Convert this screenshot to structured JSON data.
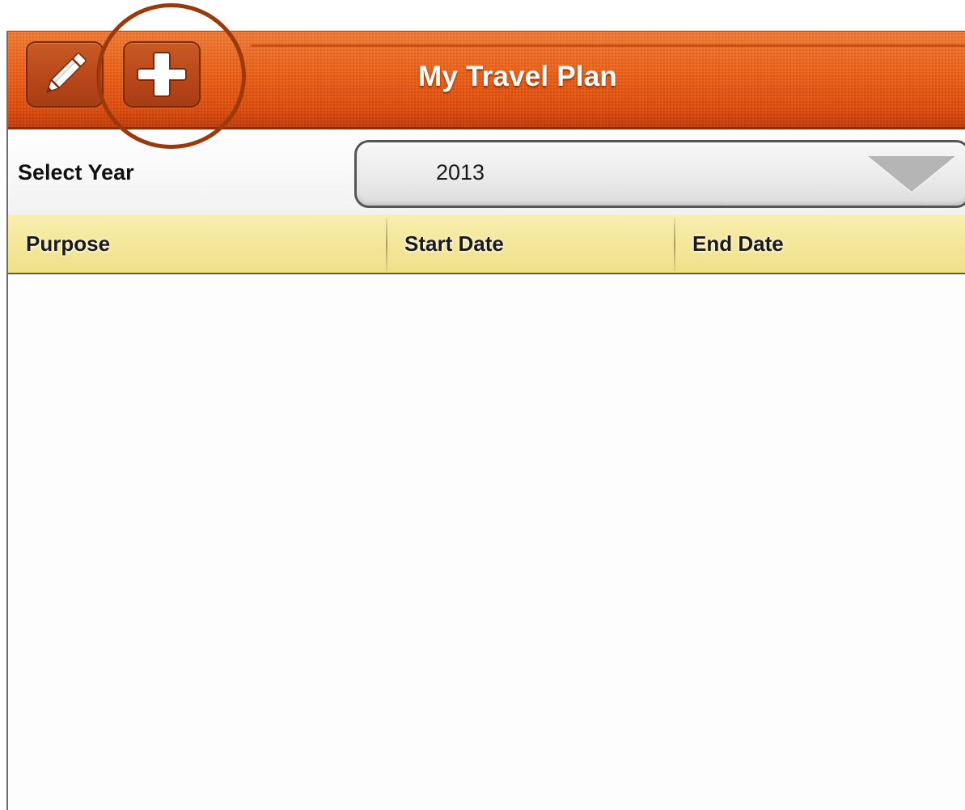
{
  "header": {
    "title": "My Travel Plan",
    "edit_icon": "pencil-icon",
    "add_icon": "plus-icon",
    "accent_color": "#ee5f15"
  },
  "year_selector": {
    "label": "Select Year",
    "selected_value": "2013",
    "arrow_icon": "triangle-down-icon"
  },
  "table": {
    "columns": [
      "Purpose",
      "Start Date",
      "End Date"
    ],
    "rows": []
  },
  "annotation": {
    "highlight_color": "#9a3a0b"
  }
}
